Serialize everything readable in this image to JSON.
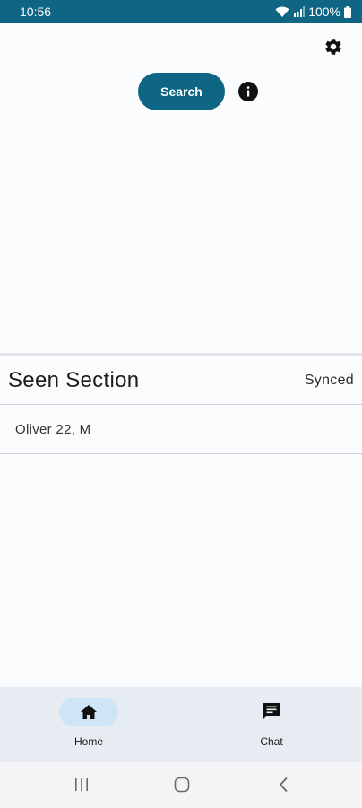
{
  "status_bar": {
    "time": "10:56",
    "battery": "100%"
  },
  "header": {
    "search_label": "Search"
  },
  "section": {
    "title": "Seen Section",
    "status": "Synced"
  },
  "list": {
    "items": [
      {
        "text": "Oliver 22, M"
      }
    ]
  },
  "bottom_nav": {
    "items": [
      {
        "label": "Home",
        "icon": "home-icon"
      },
      {
        "label": "Chat",
        "icon": "chat-icon"
      }
    ]
  },
  "colors": {
    "primary": "#0e6584",
    "nav_background": "#e6ecf1",
    "nav_active_pill": "#cde5f6"
  }
}
